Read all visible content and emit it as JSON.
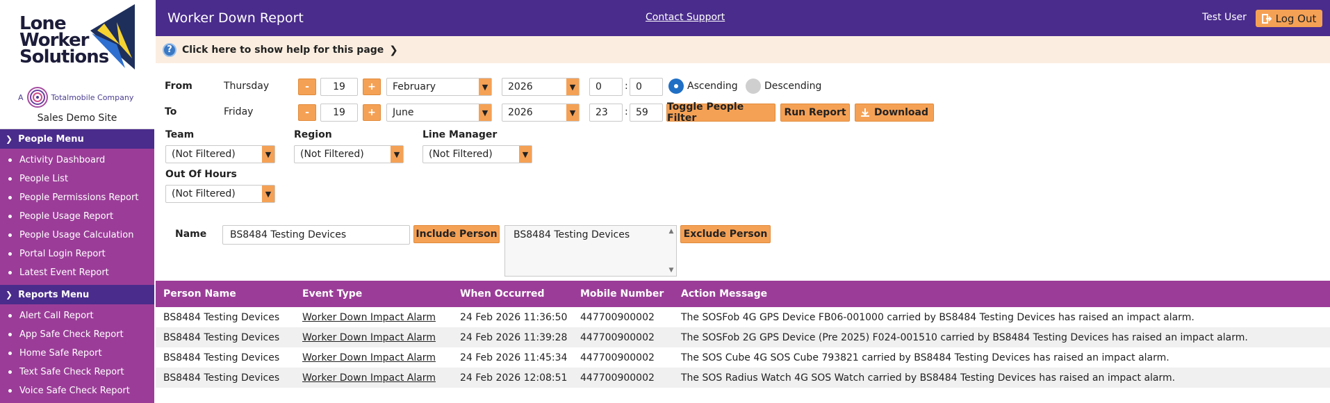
{
  "app": {
    "logo_text": [
      "Lone",
      "Worker",
      "Solutions"
    ],
    "company_prefix": "A",
    "company_name": "Totalmobile Company",
    "site_name": "Sales Demo Site"
  },
  "header": {
    "title": "Worker Down Report",
    "support_link": "Contact Support",
    "user_name": "Test User",
    "logout_label": "Log Out"
  },
  "help": {
    "text": "Click here to show help for this page"
  },
  "sidebar": {
    "people_menu": {
      "title": "People Menu",
      "items": [
        {
          "label": "Activity Dashboard"
        },
        {
          "label": "People List"
        },
        {
          "label": "People Permissions Report"
        },
        {
          "label": "People Usage Report"
        },
        {
          "label": "People Usage Calculation"
        },
        {
          "label": "Portal Login Report"
        },
        {
          "label": "Latest Event Report"
        }
      ]
    },
    "reports_menu": {
      "title": "Reports Menu",
      "items": [
        {
          "label": "Alert Call Report"
        },
        {
          "label": "App Safe Check Report"
        },
        {
          "label": "Home Safe Report"
        },
        {
          "label": "Text Safe Check Report"
        },
        {
          "label": "Voice Safe Check Report"
        }
      ]
    }
  },
  "filters": {
    "from": {
      "label": "From",
      "weekday": "Thursday",
      "minus": "-",
      "day": "19",
      "plus": "+",
      "month": "February",
      "year": "2026",
      "hour": "0",
      "minute": "0"
    },
    "to": {
      "label": "To",
      "weekday": "Friday",
      "minus": "-",
      "day": "19",
      "plus": "+",
      "month": "June",
      "year": "2026",
      "hour": "23",
      "minute": "59"
    },
    "time_sep": ":",
    "sort": {
      "ascending": "Ascending",
      "descending": "Descending",
      "selected": "ascending"
    },
    "buttons": {
      "toggle_people": "Toggle People Filter",
      "run_report": "Run Report",
      "download": "Download"
    },
    "team": {
      "label": "Team",
      "value": "(Not Filtered)"
    },
    "region": {
      "label": "Region",
      "value": "(Not Filtered)"
    },
    "line_manager": {
      "label": "Line Manager",
      "value": "(Not Filtered)"
    },
    "out_of_hours": {
      "label": "Out Of Hours",
      "value": "(Not Filtered)"
    },
    "name": {
      "label": "Name",
      "input_value": "BS8484 Testing Devices",
      "include_label": "Include Person",
      "selected_people": [
        "BS8484 Testing Devices"
      ],
      "exclude_label": "Exclude Person"
    }
  },
  "table": {
    "columns": [
      "Person Name",
      "Event Type",
      "When Occurred",
      "Mobile Number",
      "Action Message"
    ],
    "rows": [
      {
        "person": "BS8484 Testing Devices",
        "event": "Worker Down Impact Alarm",
        "when": "24 Feb 2026 11:36:50",
        "mobile": "447700900002",
        "message": "The SOSFob 4G GPS Device FB06-001000 carried by BS8484 Testing Devices has raised an impact alarm."
      },
      {
        "person": "BS8484 Testing Devices",
        "event": "Worker Down Impact Alarm",
        "when": "24 Feb 2026 11:39:28",
        "mobile": "447700900002",
        "message": "The SOSFob 2G GPS Device (Pre 2025) F024-001510 carried by BS8484 Testing Devices has raised an impact alarm."
      },
      {
        "person": "BS8484 Testing Devices",
        "event": "Worker Down Impact Alarm",
        "when": "24 Feb 2026 11:45:34",
        "mobile": "447700900002",
        "message": "The SOS Cube 4G SOS Cube 793821 carried by BS8484 Testing Devices has raised an impact alarm."
      },
      {
        "person": "BS8484 Testing Devices",
        "event": "Worker Down Impact Alarm",
        "when": "24 Feb 2026 12:08:51",
        "mobile": "447700900002",
        "message": "The SOS Radius Watch 4G SOS Watch carried by BS8484 Testing Devices has raised an impact alarm."
      }
    ]
  },
  "colors": {
    "header_purple": "#4a2c8c",
    "menu_magenta": "#9b3d98",
    "accent_orange": "#f5a155",
    "help_bg": "#fbeee0",
    "radio_blue": "#1f6fc5"
  },
  "icons": [
    "logo-mark",
    "totalmobile-swirl-icon",
    "chevron-down-icon",
    "help-question-icon",
    "chevron-right-icon",
    "logout-icon",
    "download-icon",
    "dropdown-arrow-icon"
  ]
}
